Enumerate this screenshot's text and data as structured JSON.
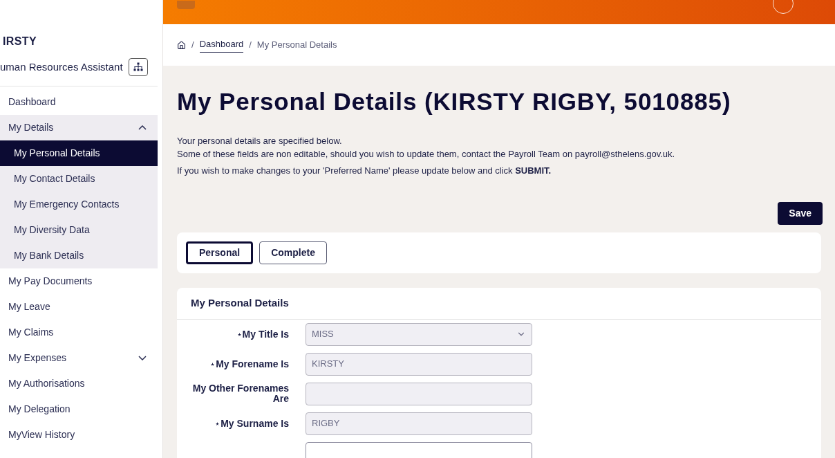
{
  "user": {
    "name": "IRSTY",
    "role": "uman Resources Assistant"
  },
  "sidebar": {
    "items": [
      {
        "label": "Dashboard",
        "selected": false
      },
      {
        "label": "My Details",
        "selected": false,
        "expanded": true,
        "children": [
          {
            "label": "My Personal Details",
            "selected": true
          },
          {
            "label": "My Contact Details",
            "selected": false
          },
          {
            "label": "My Emergency Contacts",
            "selected": false
          },
          {
            "label": "My Diversity Data",
            "selected": false
          },
          {
            "label": "My Bank Details",
            "selected": false
          }
        ]
      },
      {
        "label": "My Pay Documents",
        "selected": false
      },
      {
        "label": "My Leave",
        "selected": false
      },
      {
        "label": "My Claims",
        "selected": false
      },
      {
        "label": "My Expenses",
        "selected": false,
        "expanded": false
      },
      {
        "label": "My Authorisations",
        "selected": false
      },
      {
        "label": "My Delegation",
        "selected": false
      },
      {
        "label": "MyView History",
        "selected": false
      }
    ]
  },
  "breadcrumb": {
    "separator": "/",
    "links": [
      "Dashboard"
    ],
    "current": "My Personal Details"
  },
  "page_title": "My Personal Details (KIRSTY RIGBY, 5010885)",
  "intro": [
    "Your personal details are specified below.",
    "Some of these fields are non editable, should you wish to update them, contact the Payroll Team on payroll@sthelens.gov.uk.",
    "If you wish to make changes to your 'Preferred Name' please update below and click **SUBMIT.**"
  ],
  "save_button": "Save",
  "steps": [
    {
      "label": "Personal",
      "selected": true
    },
    {
      "label": "Complete",
      "selected": false
    }
  ],
  "form": {
    "title": "My Personal Details",
    "fields": [
      {
        "label": "My Title Is",
        "required": true,
        "kind": "select",
        "value": "MISS"
      },
      {
        "label": "My Forename Is",
        "required": true,
        "kind": "text",
        "value": "KIRSTY"
      },
      {
        "label": "My Other Forenames Are",
        "required": false,
        "kind": "text"
      },
      {
        "label": "My Surname Is",
        "required": true,
        "kind": "text",
        "value": "RIGBY"
      }
    ]
  }
}
